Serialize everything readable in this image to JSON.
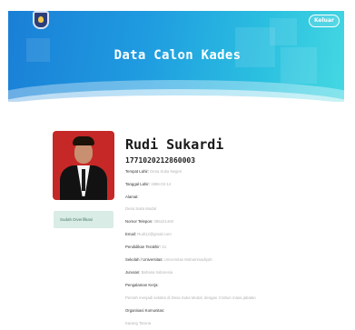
{
  "header": {
    "title": "Data Calon Kades",
    "logout_label": "Keluar"
  },
  "profile": {
    "name": "Rudi Sukardi",
    "nik": "1771020212860003",
    "status": "Sudah Diverifikasi"
  },
  "fields": {
    "tempat_lahir": {
      "label": "Tempat Lahir:",
      "value": "Desa Suka Negeri"
    },
    "tanggal_lahir": {
      "label": "Tanggal Lahir:",
      "value": "1986-02-14"
    },
    "alamat": {
      "label": "Alamat:",
      "value": "Desa Suka Modal"
    },
    "telepon": {
      "label": "Nomor Telepon:",
      "value": "085221460"
    },
    "email": {
      "label": "Email:",
      "value": "Rudi12@gmail.com"
    },
    "pendidikan": {
      "label": "Pendidikan Terakhir:",
      "value": "S1"
    },
    "universitas": {
      "label": "Sekolah / Universitas:",
      "value": "Universitas Muhammadiyah"
    },
    "jurusan": {
      "label": "Jurusan:",
      "value": "Bahasa Indonesia"
    },
    "pengalaman": {
      "label": "Pengalaman Kerja:",
      "value": "Pernah menjadi sekdes di Desa Suka Modal, dengan 3 tahun masa jabatan"
    },
    "organisasi": {
      "label": "Organisasi Komunitas:",
      "value": "Karang Taruna"
    }
  },
  "colors": {
    "banner_start": "#1a7fd6",
    "banner_end": "#45d8e2",
    "photo_bg": "#c62828",
    "badge_bg": "#d9ece6",
    "badge_text": "#4a7a6a"
  },
  "icons": {
    "logo": "regency-crest-logo"
  }
}
